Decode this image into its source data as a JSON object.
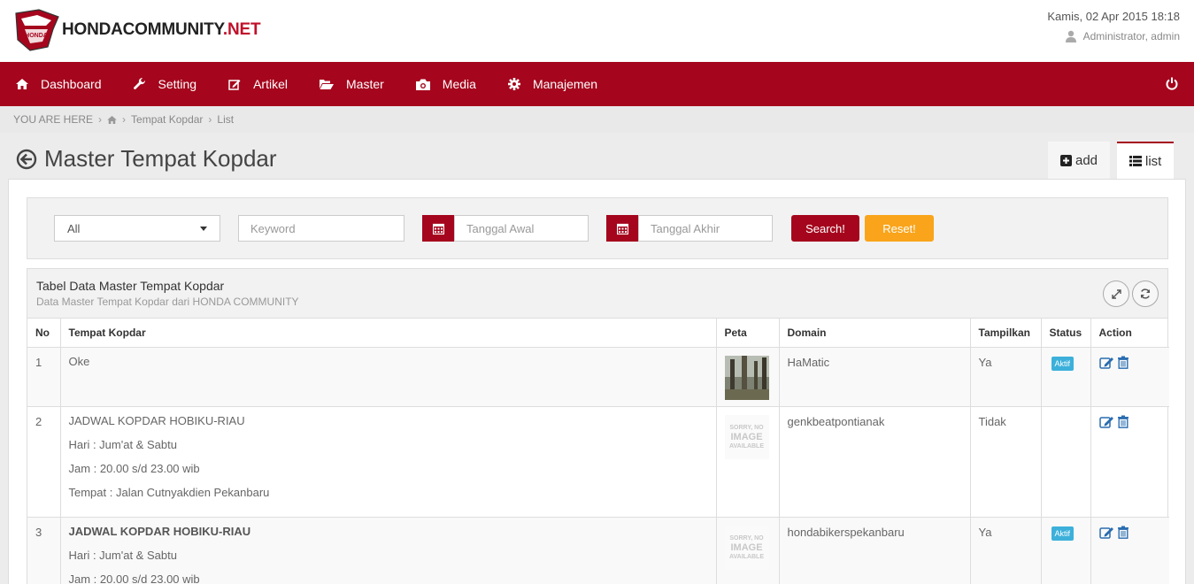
{
  "brand": {
    "name_main": "HONDACOMMUNITY",
    "name_suffix": ".NET",
    "badge_text": "HONDA",
    "brand_color": "#a5061d"
  },
  "header": {
    "datetime": "Kamis, 02 Apr 2015 18:18",
    "user": "Administrator, admin"
  },
  "nav": {
    "items": [
      {
        "label": "Dashboard",
        "icon": "home-icon"
      },
      {
        "label": "Setting",
        "icon": "wrench-icon"
      },
      {
        "label": "Artikel",
        "icon": "edit-icon"
      },
      {
        "label": "Master",
        "icon": "folder-open-icon"
      },
      {
        "label": "Media",
        "icon": "camera-icon"
      },
      {
        "label": "Manajemen",
        "icon": "gear-icon"
      }
    ],
    "power_icon": "power-icon"
  },
  "breadcrumb": {
    "prefix": "YOU ARE HERE",
    "items": [
      "Tempat Kopdar",
      "List"
    ]
  },
  "page": {
    "title": "Master Tempat Kopdar",
    "tabs": {
      "add": "add",
      "list": "list"
    }
  },
  "filter": {
    "select_value": "All",
    "keyword_placeholder": "Keyword",
    "date_start_placeholder": "Tanggal Awal",
    "date_end_placeholder": "Tanggal Akhir",
    "search_label": "Search!",
    "reset_label": "Reset!",
    "search_color": "#a5061d",
    "reset_color": "#f9a41a"
  },
  "table": {
    "title": "Tabel Data Master Tempat Kopdar",
    "subtitle": "Data Master Tempat Kopdar dari HONDA COMMUNITY",
    "columns": [
      "No",
      "Tempat Kopdar",
      "Peta",
      "Domain",
      "Tampilkan",
      "Status",
      "Action"
    ],
    "no_image": {
      "line1": "SORRY, NO",
      "line2": "IMAGE",
      "line3": "AVAILABLE"
    },
    "rows": [
      {
        "no": "1",
        "lines": [
          "Oke"
        ],
        "domain": "HaMatic",
        "tampilkan": "Ya",
        "status": "Aktif"
      },
      {
        "no": "2",
        "lines": [
          "JADWAL KOPDAR HOBIKU-RIAU",
          "Hari : Jum'at & Sabtu",
          "Jam : 20.00 s/d 23.00 wib",
          "Tempat : Jalan Cutnyakdien Pekanbaru"
        ],
        "domain": "genkbeatpontianak",
        "tampilkan": "Tidak",
        "status": ""
      },
      {
        "no": "3",
        "lines": [
          "JADWAL KOPDAR HOBIKU-RIAU",
          "Hari : Jum'at & Sabtu",
          "Jam : 20.00 s/d 23.00 wib"
        ],
        "domain": "hondabikerspekanbaru",
        "tampilkan": "Ya",
        "status": "Aktif"
      }
    ]
  }
}
